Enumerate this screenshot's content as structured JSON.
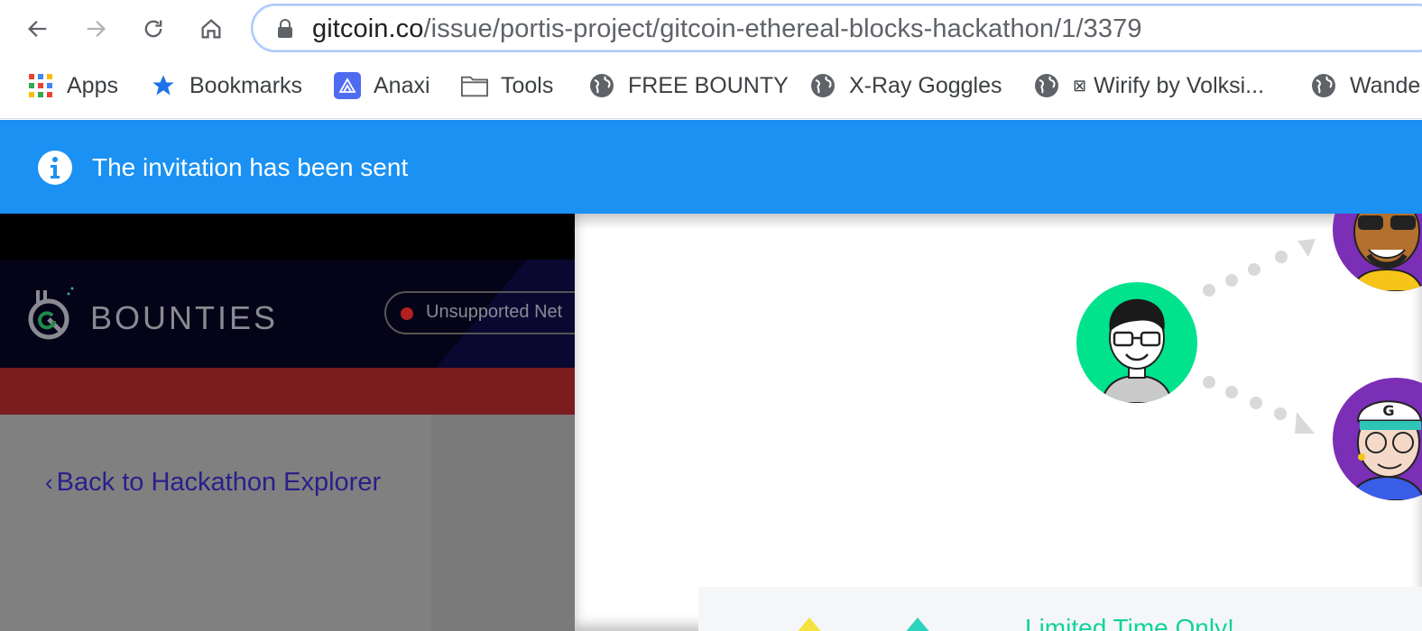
{
  "browser": {
    "url_domain": "gitcoin.co",
    "url_path": "/issue/portis-project/gitcoin-ethereal-blocks-hackathon/1/3379"
  },
  "bookmarks": [
    {
      "label": "Apps",
      "icon": "apps-grid-icon"
    },
    {
      "label": "Bookmarks",
      "icon": "star-icon"
    },
    {
      "label": "Anaxi",
      "icon": "anaxi-icon"
    },
    {
      "label": "Tools",
      "icon": "folder-icon"
    },
    {
      "label": "FREE BOUNTY",
      "icon": "globe-icon"
    },
    {
      "label": "X-Ray Goggles",
      "icon": "globe-icon"
    },
    {
      "label": "Wirify by Volksi...",
      "icon": "globe-icon"
    },
    {
      "label": "Wande",
      "icon": "globe-icon"
    }
  ],
  "banner": {
    "message": "The invitation has been sent",
    "color": "#1a91f3"
  },
  "site": {
    "logo_text": "BOUNTIES",
    "network_status": "Unsupported Net",
    "back_link": "Back to Hackathon Explorer"
  },
  "modal": {
    "promo_text": "Limited Time Only!"
  }
}
